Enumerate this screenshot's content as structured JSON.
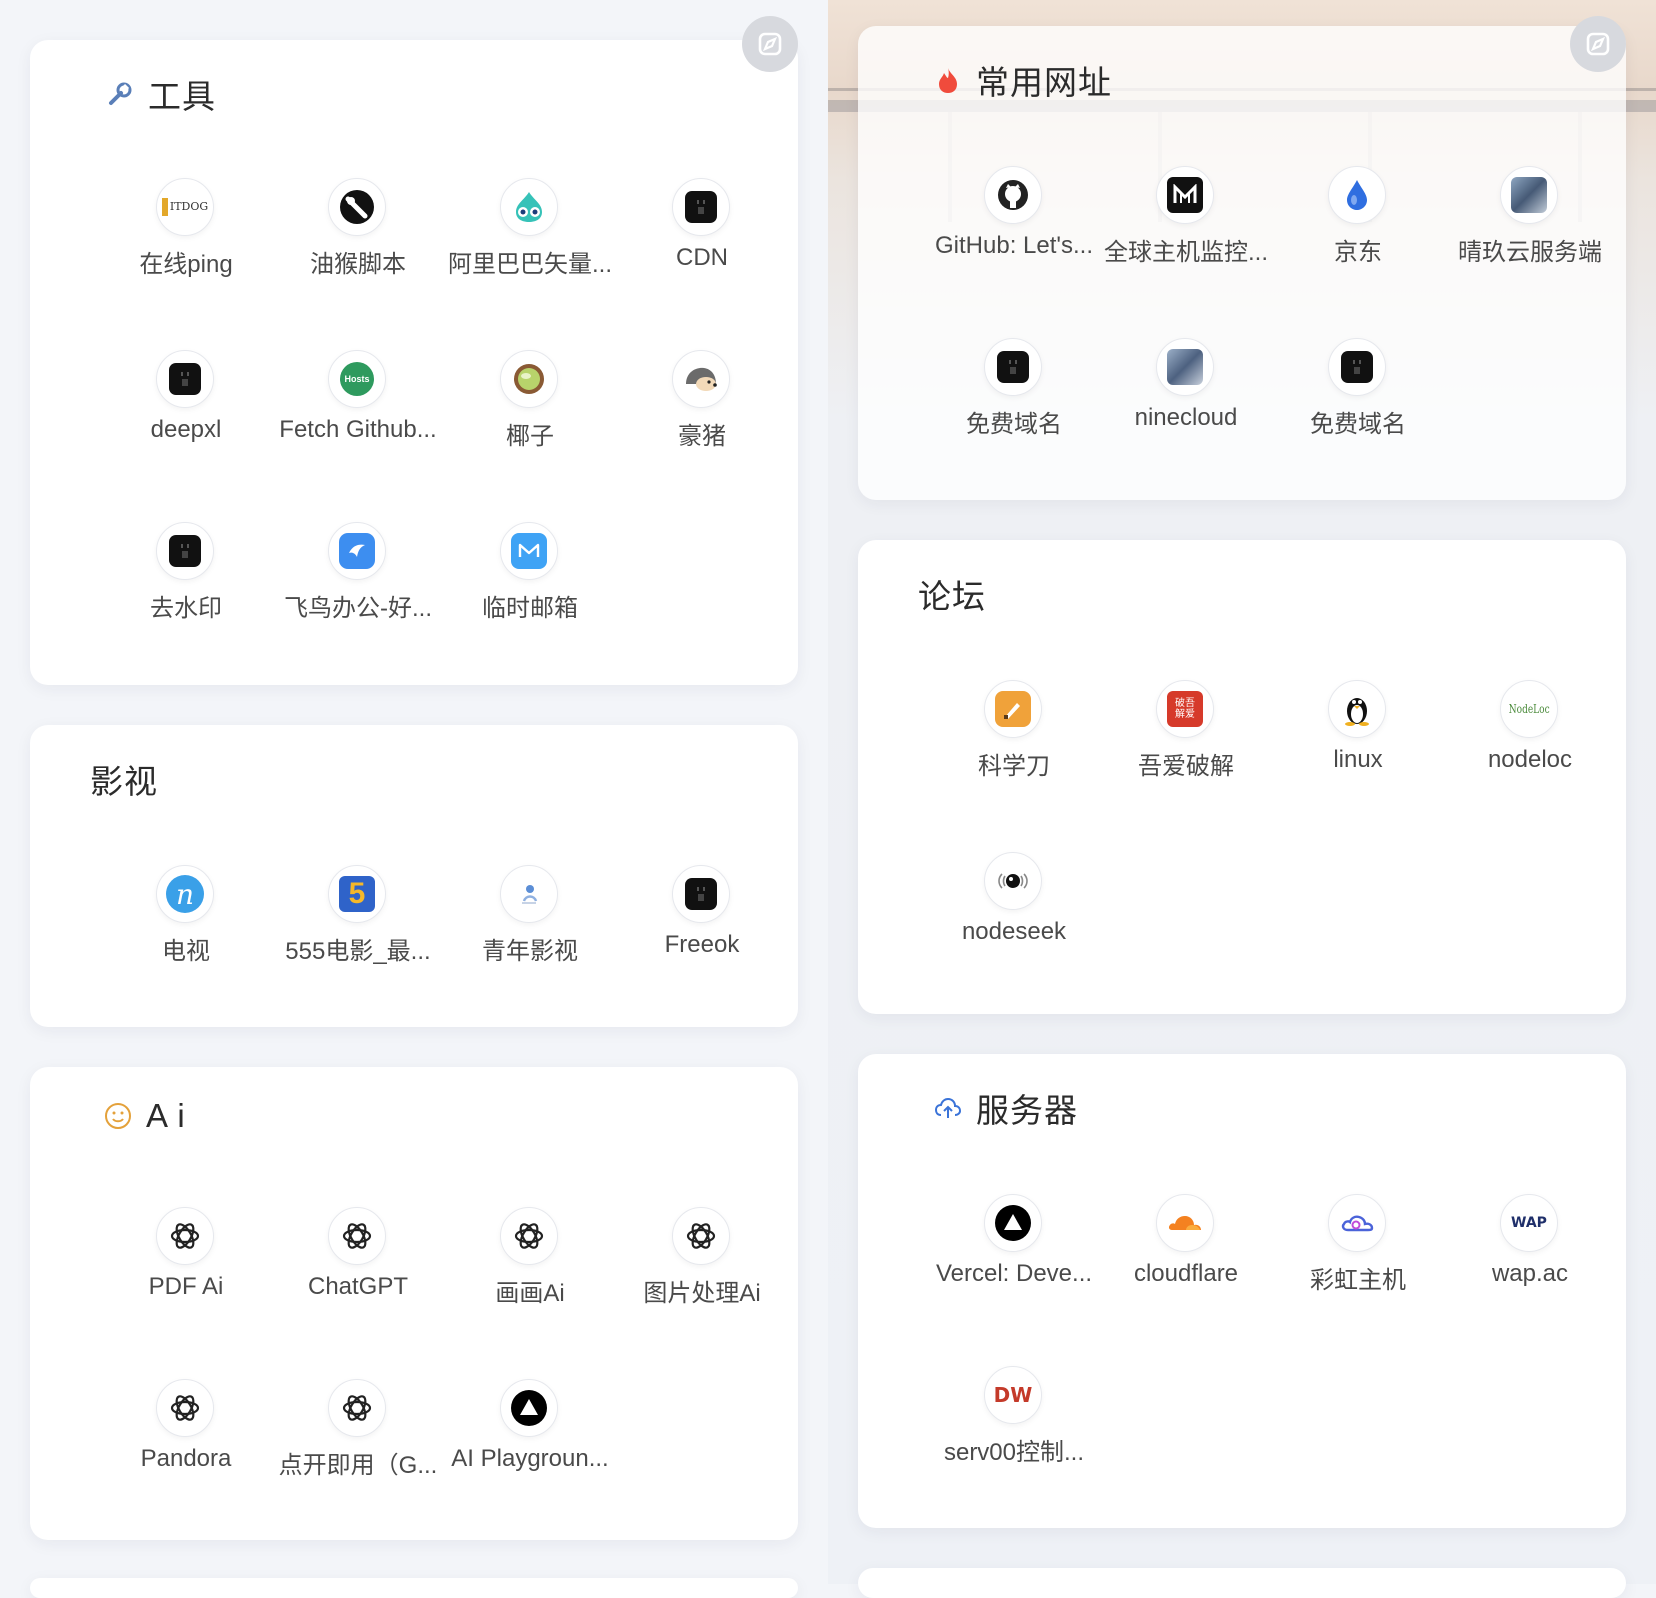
{
  "colors": {
    "fire": "#f04b3c",
    "wrench": "#5a7fb8",
    "smile": "#e4a13a",
    "cloud": "#3a73d8"
  },
  "cards": {
    "tools": {
      "title": "工具",
      "items": [
        "在线ping",
        "油猴脚本",
        "阿里巴巴矢量...",
        "CDN",
        "deepxl",
        "Fetch Github...",
        "椰子",
        "豪猪",
        "去水印",
        "飞鸟办公-好...",
        "临时邮箱"
      ]
    },
    "video": {
      "title": "影视",
      "items": [
        "电视",
        "555电影_最...",
        "青年影视",
        "Freeok"
      ]
    },
    "ai": {
      "title": "A i",
      "items": [
        "PDF Ai",
        "ChatGPT",
        "画画Ai",
        "图片处理Ai",
        "Pandora",
        "点开即用（G...",
        "AI Playgroun..."
      ]
    },
    "common": {
      "title": "常用网址",
      "items": [
        "GitHub: Let's...",
        "全球主机监控...",
        "京东",
        "晴玖云服务端",
        "免费域名",
        "ninecloud",
        "免费域名"
      ]
    },
    "forum": {
      "title": "论坛",
      "items": [
        "科学刀",
        "吾爱破解",
        "linux",
        "nodeloc",
        "nodeseek"
      ]
    },
    "server": {
      "title": "服务器",
      "items": [
        "Vercel: Deve...",
        "cloudflare",
        "彩虹主机",
        "wap.ac",
        "serv00控制..."
      ]
    }
  },
  "icon_text": {
    "itdog": "ITDOG",
    "hosts": "Hosts",
    "pojie": "破吾解爱",
    "nodeloc": "NodeLoc",
    "wap": "WAP",
    "dw": "DW",
    "dianying5": "5"
  }
}
